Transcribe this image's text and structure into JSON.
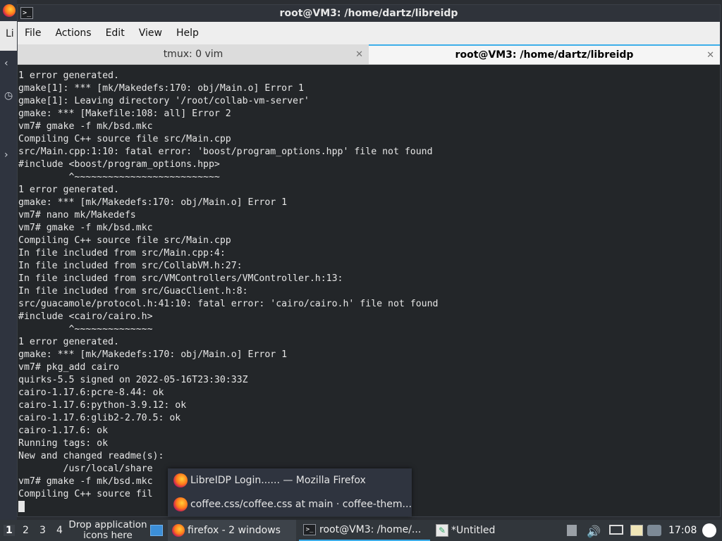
{
  "window": {
    "title": "root@VM3: /home/dartz/libreidp",
    "terminal_icon": ">_"
  },
  "desktop_left": {
    "strip_label": "Li",
    "glyphs": [
      "◷",
      "‹",
      "›"
    ]
  },
  "menubar": {
    "items": [
      "File",
      "Actions",
      "Edit",
      "View",
      "Help"
    ]
  },
  "tabs": [
    {
      "label": "tmux: 0 vim",
      "close": "✕",
      "active": false
    },
    {
      "label": "root@VM3: /home/dartz/libreidp",
      "close": "✕",
      "active": true
    }
  ],
  "terminal": {
    "lines": [
      "1 error generated.",
      "gmake[1]: *** [mk/Makedefs:170: obj/Main.o] Error 1",
      "gmake[1]: Leaving directory '/root/collab-vm-server'",
      "gmake: *** [Makefile:108: all] Error 2",
      "vm7# gmake -f mk/bsd.mkc",
      "Compiling C++ source file src/Main.cpp",
      "src/Main.cpp:1:10: fatal error: 'boost/program_options.hpp' file not found",
      "#include <boost/program_options.hpp>",
      "         ^~~~~~~~~~~~~~~~~~~~~~~~~~~",
      "1 error generated.",
      "gmake: *** [mk/Makedefs:170: obj/Main.o] Error 1",
      "vm7# nano mk/Makedefs",
      "vm7# gmake -f mk/bsd.mkc",
      "Compiling C++ source file src/Main.cpp",
      "In file included from src/Main.cpp:4:",
      "In file included from src/CollabVM.h:27:",
      "In file included from src/VMControllers/VMController.h:13:",
      "In file included from src/GuacClient.h:8:",
      "src/guacamole/protocol.h:41:10: fatal error: 'cairo/cairo.h' file not found",
      "#include <cairo/cairo.h>",
      "         ^~~~~~~~~~~~~~~",
      "1 error generated.",
      "gmake: *** [mk/Makedefs:170: obj/Main.o] Error 1",
      "vm7# pkg_add cairo",
      "quirks-5.5 signed on 2022-05-16T23:30:33Z",
      "cairo-1.17.6:pcre-8.44: ok",
      "cairo-1.17.6:python-3.9.12: ok",
      "cairo-1.17.6:glib2-2.70.5: ok",
      "cairo-1.17.6: ok",
      "Running tags: ok",
      "New and changed readme(s):",
      "        /usr/local/share",
      "vm7# gmake -f mk/bsd.mkc",
      "Compiling C++ source fil"
    ]
  },
  "popup": {
    "items": [
      {
        "label": "LibreIDP Login...... — Mozilla Firefox"
      },
      {
        "label": "coffee.css/coffee.css at main · coffee-them..."
      }
    ]
  },
  "taskbar": {
    "workspaces": [
      "1",
      "2",
      "3",
      "4"
    ],
    "drop_hint": "Drop application icons here",
    "tasks": [
      {
        "label": "firefox - 2 windows"
      },
      {
        "label": "root@VM3: /home/..."
      },
      {
        "label": "*Untitled"
      }
    ],
    "clock": "17:08"
  }
}
